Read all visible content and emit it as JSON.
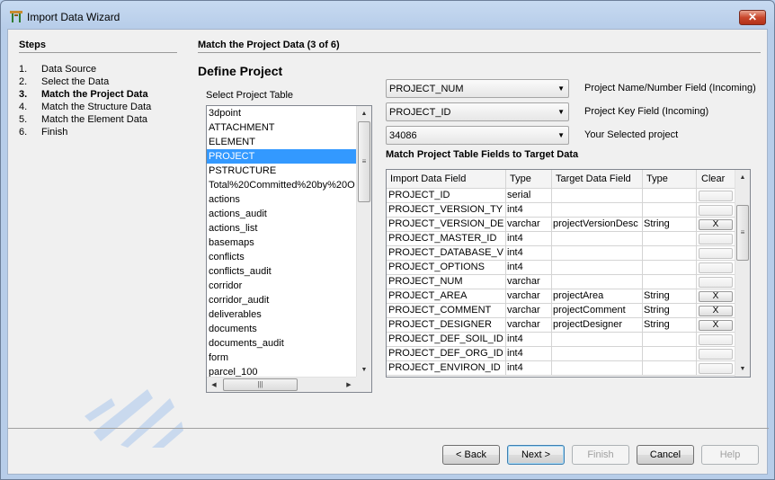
{
  "window": {
    "title": "Import Data Wizard"
  },
  "steps": {
    "title": "Steps",
    "items": [
      {
        "num": "1.",
        "label": "Data Source"
      },
      {
        "num": "2.",
        "label": "Select the Data"
      },
      {
        "num": "3.",
        "label": "Match the Project Data",
        "current": true
      },
      {
        "num": "4.",
        "label": "Match the Structure Data"
      },
      {
        "num": "5.",
        "label": "Match the Element Data"
      },
      {
        "num": "6.",
        "label": "Finish"
      }
    ]
  },
  "main": {
    "title": "Match the Project Data (3 of 6)",
    "subtitle": "Define Project",
    "select_label": "Select Project Table",
    "tables": [
      "3dpoint",
      "ATTACHMENT",
      "ELEMENT",
      "PROJECT",
      "PSTRUCTURE",
      "Total%20Committed%20by%20O",
      "actions",
      "actions_audit",
      "actions_list",
      "basemaps",
      "conflicts",
      "conflicts_audit",
      "corridor",
      "corridor_audit",
      "deliverables",
      "documents",
      "documents_audit",
      "form",
      "parcel_100"
    ],
    "selected_table": "PROJECT",
    "fields": [
      {
        "value": "PROJECT_NUM",
        "label": "Project Name/Number Field (Incoming)"
      },
      {
        "value": "PROJECT_ID",
        "label": "Project Key Field (Incoming)"
      },
      {
        "value": "34086",
        "label": "Your Selected project"
      }
    ],
    "match_title": "Match Project Table Fields to Target Data",
    "grid_headers": {
      "import": "Import Data Field",
      "type": "Type",
      "target": "Target Data Field",
      "type2": "Type",
      "clear": "Clear"
    },
    "grid_rows": [
      {
        "import": "PROJECT_ID",
        "type": "serial",
        "target": "",
        "type2": "",
        "clear": ""
      },
      {
        "import": "PROJECT_VERSION_TYPE",
        "type": "int4",
        "target": "",
        "type2": "",
        "clear": ""
      },
      {
        "import": "PROJECT_VERSION_DESC",
        "type": "varchar",
        "target": "projectVersionDesc",
        "type2": "String",
        "clear": "X"
      },
      {
        "import": "PROJECT_MASTER_ID",
        "type": "int4",
        "target": "",
        "type2": "",
        "clear": ""
      },
      {
        "import": "PROJECT_DATABASE_V...",
        "type": "int4",
        "target": "",
        "type2": "",
        "clear": ""
      },
      {
        "import": "PROJECT_OPTIONS",
        "type": "int4",
        "target": "",
        "type2": "",
        "clear": ""
      },
      {
        "import": "PROJECT_NUM",
        "type": "varchar",
        "target": "",
        "type2": "",
        "clear": ""
      },
      {
        "import": "PROJECT_AREA",
        "type": "varchar",
        "target": "projectArea",
        "type2": "String",
        "clear": "X"
      },
      {
        "import": "PROJECT_COMMENT",
        "type": "varchar",
        "target": "projectComment",
        "type2": "String",
        "clear": "X"
      },
      {
        "import": "PROJECT_DESIGNER",
        "type": "varchar",
        "target": "projectDesigner",
        "type2": "String",
        "clear": "X"
      },
      {
        "import": "PROJECT_DEF_SOIL_ID",
        "type": "int4",
        "target": "",
        "type2": "",
        "clear": ""
      },
      {
        "import": "PROJECT_DEF_ORG_ID",
        "type": "int4",
        "target": "",
        "type2": "",
        "clear": ""
      },
      {
        "import": "PROJECT_ENVIRON_ID",
        "type": "int4",
        "target": "",
        "type2": "",
        "clear": ""
      }
    ]
  },
  "buttons": {
    "back": "< Back",
    "next": "Next >",
    "finish": "Finish",
    "cancel": "Cancel",
    "help": "Help"
  }
}
